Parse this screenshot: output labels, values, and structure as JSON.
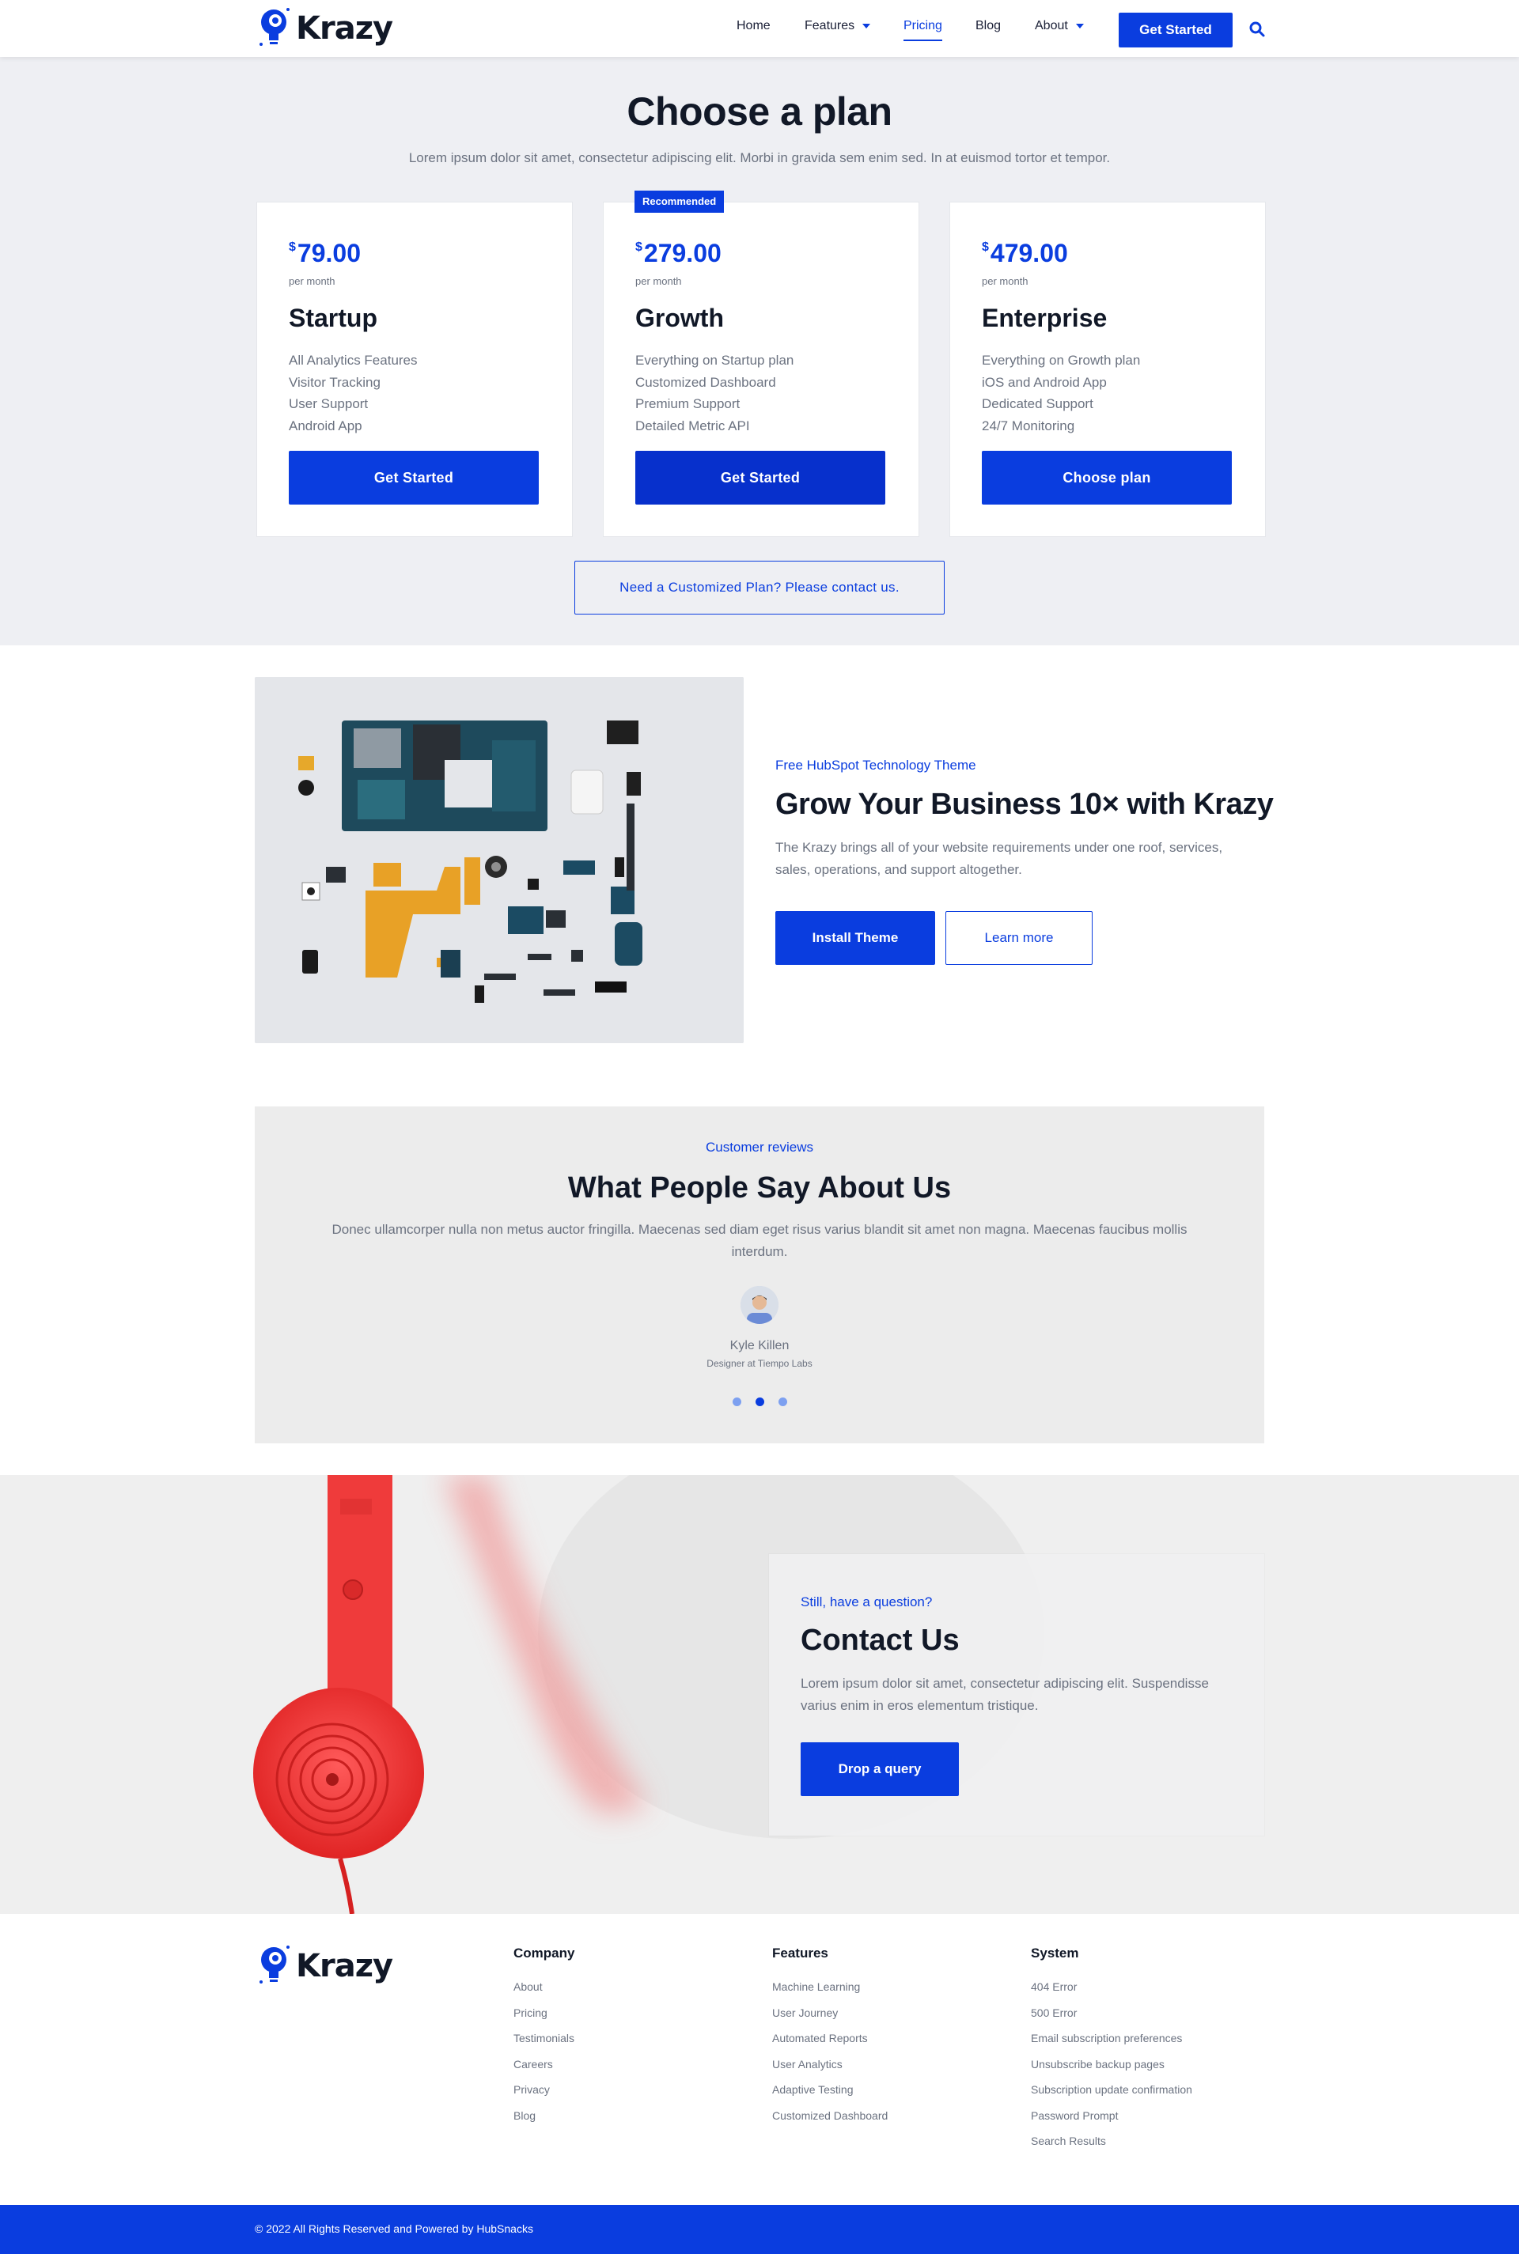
{
  "header": {
    "brand": "Krazy",
    "nav": [
      {
        "label": "Home"
      },
      {
        "label": "Features"
      },
      {
        "label": "Pricing"
      },
      {
        "label": "Blog"
      },
      {
        "label": "About"
      }
    ],
    "cta_label": "Get Started",
    "icons": {
      "logo": "bulb-gear-logo",
      "search": "search-icon"
    }
  },
  "pricing": {
    "title": "Choose a plan",
    "subtitle": "Lorem ipsum dolor sit amet, consectetur adipiscing elit. Morbi in gravida sem enim sed. In at euismod tortor et tempor.",
    "badge": "Recommended",
    "currency": "$",
    "per_label": "per month",
    "plans": [
      {
        "price": "79.00",
        "name": "Startup",
        "features": [
          "All Analytics Features",
          "Visitor Tracking",
          "User Support",
          "Android App"
        ],
        "button": "Get Started"
      },
      {
        "price": "279.00",
        "name": "Growth",
        "features": [
          "Everything on Startup plan",
          "Customized Dashboard",
          "Premium Support",
          "Detailed Metric API"
        ],
        "button": "Get Started"
      },
      {
        "price": "479.00",
        "name": "Enterprise",
        "features": [
          "Everything on Growth plan",
          "iOS and Android App",
          "Dedicated Support",
          "24/7 Monitoring"
        ],
        "button": "Choose plan"
      }
    ],
    "custom_plan_label": "Need a Customized Plan? Please contact us."
  },
  "grow": {
    "eyebrow": "Free HubSpot Technology Theme",
    "title": "Grow Your Business 10× with Krazy",
    "text": "The Krazy brings all of your website requirements under one roof, services, sales, operations, and support altogether.",
    "btn_primary": "Install Theme",
    "btn_secondary": "Learn more"
  },
  "reviews": {
    "eyebrow": "Customer reviews",
    "title": "What People Say About Us",
    "text": "Donec ullamcorper nulla non metus auctor fringilla. Maecenas sed diam eget risus varius blandit sit amet non magna. Maecenas faucibus mollis interdum.",
    "name": "Kyle Killen",
    "role": "Designer at Tiempo Labs",
    "active_slide": 2,
    "total_slides": 3
  },
  "contact": {
    "eyebrow": "Still, have a question?",
    "title": "Contact Us",
    "text": "Lorem ipsum dolor sit amet, consectetur adipiscing elit. Suspendisse varius enim in eros elementum tristique.",
    "button": "Drop a query"
  },
  "footer": {
    "brand": "Krazy",
    "columns": [
      {
        "title": "Company",
        "links": [
          "About",
          "Pricing",
          "Testimonials",
          "Careers",
          "Privacy",
          "Blog"
        ]
      },
      {
        "title": "Features",
        "links": [
          "Machine Learning",
          "User Journey",
          "Automated Reports",
          "User Analytics",
          "Adaptive Testing",
          "Customized Dashboard"
        ]
      },
      {
        "title": "System",
        "links": [
          "404 Error",
          "500 Error",
          "Email subscription preferences",
          "Unsubscribe backup pages",
          "Subscription update confirmation",
          "Password Prompt",
          "Search Results"
        ]
      }
    ],
    "copyright": "© 2022 All Rights Reserved and Powered by HubSnacks"
  },
  "colors": {
    "accent": "#0a3ddf",
    "section_bg": "#eeeff3",
    "footer_bar": "#0a3ddf",
    "phone_red": "#ef3b3b"
  }
}
